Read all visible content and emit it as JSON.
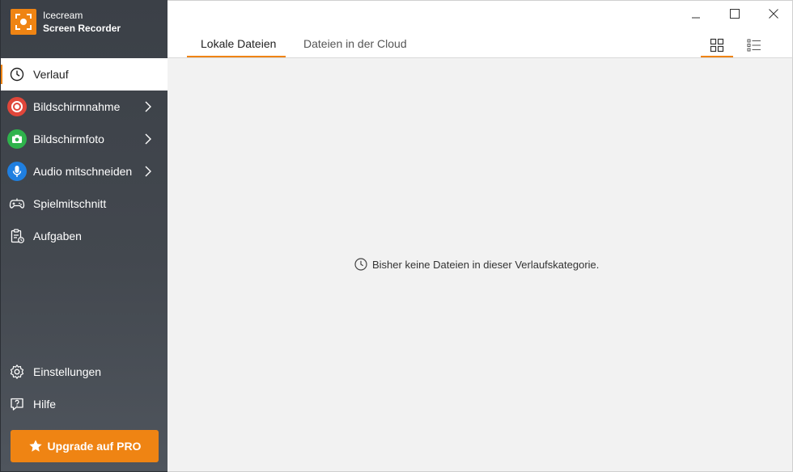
{
  "app": {
    "title_line1": "Icecream",
    "title_line2": "Screen Recorder",
    "accent": "#ef8413"
  },
  "sidebar": {
    "items": [
      {
        "label": "Verlauf",
        "icon": "clock-icon",
        "active": true,
        "submenu": false
      },
      {
        "label": "Bildschirmnahme",
        "icon": "record-icon",
        "color": "#e0463a",
        "submenu": true
      },
      {
        "label": "Bildschirmfoto",
        "icon": "camera-icon",
        "color": "#2fb34c",
        "submenu": true
      },
      {
        "label": "Audio mitschneiden",
        "icon": "microphone-icon",
        "color": "#1f7fe0",
        "submenu": true
      },
      {
        "label": "Spielmitschnitt",
        "icon": "gamepad-icon",
        "submenu": false
      },
      {
        "label": "Aufgaben",
        "icon": "tasks-icon",
        "submenu": false
      }
    ],
    "bottom_items": [
      {
        "label": "Einstellungen",
        "icon": "gear-icon"
      },
      {
        "label": "Hilfe",
        "icon": "help-icon"
      }
    ],
    "upgrade_label": "Upgrade auf PRO"
  },
  "tabs": [
    {
      "label": "Lokale Dateien",
      "active": true
    },
    {
      "label": "Dateien in der Cloud",
      "active": false
    }
  ],
  "view_modes": [
    {
      "icon": "grid-view-icon",
      "active": true
    },
    {
      "icon": "list-view-icon",
      "active": false
    }
  ],
  "content": {
    "empty_message": "Bisher keine Dateien in dieser Verlaufskategorie."
  }
}
